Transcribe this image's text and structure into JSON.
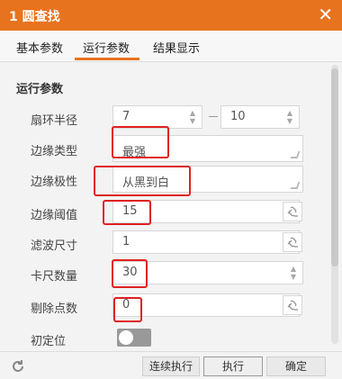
{
  "window": {
    "title": "1 圆查找",
    "close_glyph": "✕"
  },
  "tabs": [
    {
      "label": "基本参数",
      "active": false
    },
    {
      "label": "运行参数",
      "active": true
    },
    {
      "label": "结果显示",
      "active": false
    }
  ],
  "section": {
    "title": "运行参数"
  },
  "params": {
    "ring_radius": {
      "label": "扇环半径",
      "min": "7",
      "max": "10"
    },
    "edge_type": {
      "label": "边缘类型",
      "value": "最强"
    },
    "edge_polarity": {
      "label": "边缘极性",
      "value": "从黑到白"
    },
    "edge_threshold": {
      "label": "边缘阈值",
      "value": "15"
    },
    "filter_size": {
      "label": "滤波尺寸",
      "value": "1"
    },
    "caliper_count": {
      "label": "卡尺数量",
      "value": "30"
    },
    "remove_points": {
      "label": "剔除点数",
      "value": "0"
    },
    "initial_position": {
      "label": "初定位",
      "enabled": false
    }
  },
  "buttons": {
    "run_continuous": "连续执行",
    "run": "执行",
    "confirm": "确定"
  },
  "icons": {
    "close": "close-icon",
    "link": "link-icon",
    "reset": "reset-icon"
  },
  "colors": {
    "accent": "#e8731f",
    "highlight": "#e02020"
  }
}
